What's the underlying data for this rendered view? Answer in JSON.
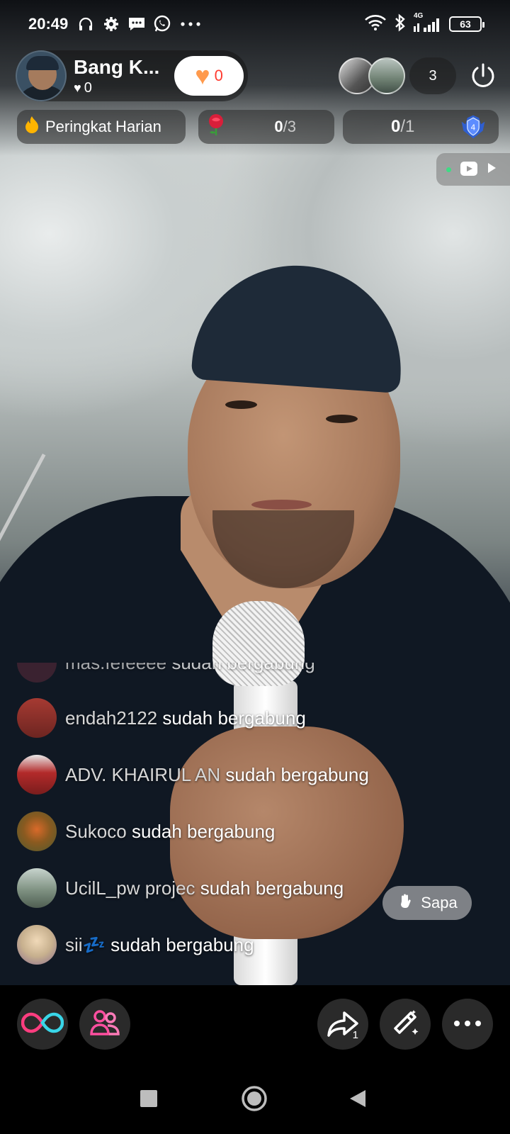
{
  "status_bar": {
    "time": "20:49",
    "network_type": "4G",
    "battery": "63",
    "icons": [
      "headphones-icon",
      "gear-icon",
      "message-icon",
      "whatsapp-icon",
      "more-dots-icon",
      "wifi-icon",
      "bluetooth-icon",
      "signal-icon",
      "battery-icon"
    ]
  },
  "host": {
    "name": "Bang K...",
    "likes": "0",
    "follow_count": "0"
  },
  "viewers": {
    "count": "3"
  },
  "rank": {
    "label": "Peringkat Harian"
  },
  "gift_goal": {
    "current": "0",
    "total": "/3"
  },
  "task_goal": {
    "current": "0",
    "total": "/1"
  },
  "feed": [
    {
      "username": "mas.fefeeee",
      "message": "sudah bergabung",
      "avatar_color": "#3a2230"
    },
    {
      "username": "endah2122",
      "message": "sudah bergabung",
      "avatar_color": "#8a2f2a"
    },
    {
      "username": "ADV. KHAIRUL AN",
      "message": "sudah bergabung",
      "avatar_color": "#b32a2a"
    },
    {
      "username": "Sukoco",
      "message": "sudah bergabung",
      "avatar_color": "#6f6a2e"
    },
    {
      "username": "UcilL_pw projec",
      "message": "sudah bergabung",
      "avatar_color": "#7f9282"
    },
    {
      "username": "sii💤",
      "message": "sudah bergabung",
      "avatar_color": "#c7b08e"
    }
  ],
  "sapa": {
    "label": "Sapa"
  },
  "bottom_actions": {
    "share_count": "1"
  },
  "colors": {
    "follow_heart": "#ff9a4d",
    "follow_count": "#ff3b30",
    "accent_pink": "#ff3d7f",
    "accent_cyan": "#39d6e8"
  }
}
